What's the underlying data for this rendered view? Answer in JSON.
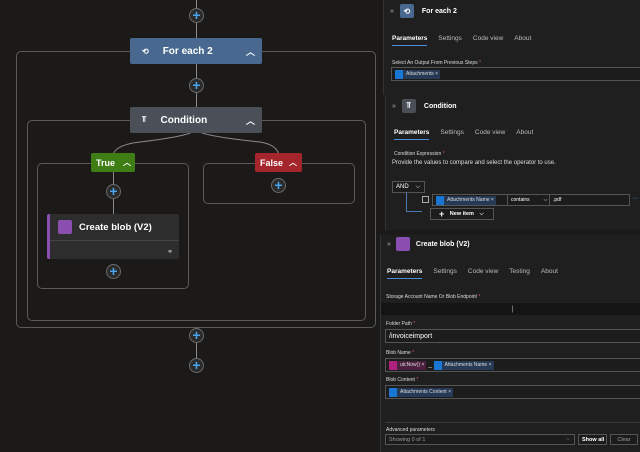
{
  "canvas": {
    "foreach": {
      "title": "For each 2"
    },
    "condition": {
      "title": "Condition"
    },
    "true_branch": {
      "label": "True"
    },
    "false_branch": {
      "label": "False"
    },
    "create_blob": {
      "title": "Create blob (V2)"
    }
  },
  "foreach_panel": {
    "title": "For each 2",
    "tabs": [
      "Parameters",
      "Settings",
      "Code view",
      "About"
    ],
    "field_label": "Select An Output From Previous Steps",
    "token": "Attachments"
  },
  "condition_panel": {
    "title": "Condition",
    "tabs": [
      "Parameters",
      "Settings",
      "Code view",
      "About"
    ],
    "field_label": "Condition Expression",
    "description": "Provide the values to compare and select the operator to use.",
    "group_operator": "AND",
    "left_token": "Attachments Name",
    "operator": "contains",
    "right_value": ".pdf",
    "new_item": "New item"
  },
  "blob_panel": {
    "title": "Create blob (V2)",
    "tabs": [
      "Parameters",
      "Settings",
      "Code view",
      "Testing",
      "About"
    ],
    "storage_label": "Storage Account Name Or Blob Endpoint",
    "storage_value": "|",
    "folder_label": "Folder Path",
    "folder_value": "/invoiceimport",
    "blobname_label": "Blob Name",
    "blobname_fx": "utcNow()",
    "blobname_sep": "_",
    "blobname_token": "Attachments Name",
    "content_label": "Blob Content",
    "content_token": "Attachments Content",
    "advanced_label": "Advanced parameters",
    "advanced_value": "Showing 0 of 1",
    "show_all": "Show all",
    "clear": "Clear"
  },
  "colors": {
    "foreach": "#48688f",
    "condition": "#4a4f58",
    "true": "#3f7d15",
    "false": "#a4262c",
    "blob": "#8a4fb0",
    "accent": "#4a90d9"
  }
}
